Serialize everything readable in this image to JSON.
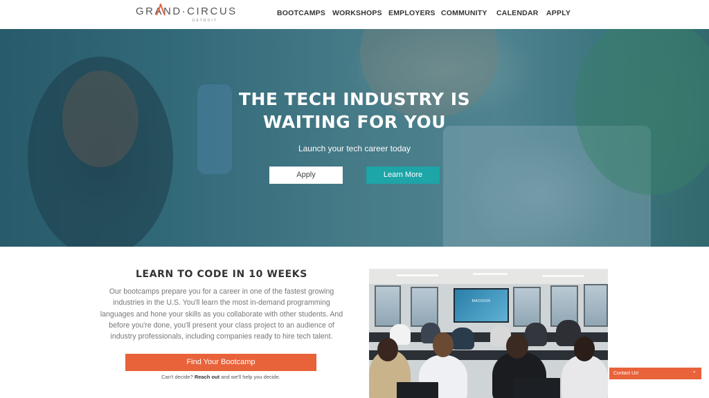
{
  "header": {
    "logo_text": "GRAND·CIRCUS",
    "logo_sub": "DETROIT",
    "nav": [
      {
        "label": "BOOTCAMPS"
      },
      {
        "label": "WORKSHOPS"
      },
      {
        "label": "EMPLOYERS"
      },
      {
        "label": "COMMUNITY"
      },
      {
        "label": "CALENDAR"
      },
      {
        "label": "APPLY"
      }
    ]
  },
  "hero": {
    "title_line1": "THE TECH INDUSTRY IS",
    "title_line2": "WAITING FOR YOU",
    "subtitle": "Launch your tech career today",
    "apply_label": "Apply",
    "learn_more_label": "Learn More"
  },
  "learn": {
    "title": "LEARN TO CODE IN 10 WEEKS",
    "body": "Our bootcamps prepare you for a career in one of the fastest growing industries in the U.S. You'll learn the most in-demand programming languages and hone your skills as you collaborate with other students. And before you're done, you'll present your class project to an audience of industry professionals, including companies ready to hire tech talent.",
    "button_label": "Find Your Bootcamp",
    "cant_decide_prefix": "Can't decide?",
    "reach_out": "Reach out",
    "cant_decide_suffix": "and we'll help you decide."
  },
  "photo": {
    "screen_text": "MADISON"
  },
  "contact": {
    "label": "Contact Us!",
    "chevron_icon": "chevron-up-icon"
  },
  "colors": {
    "accent_orange": "#e8623a",
    "accent_teal": "#1da5a8"
  }
}
